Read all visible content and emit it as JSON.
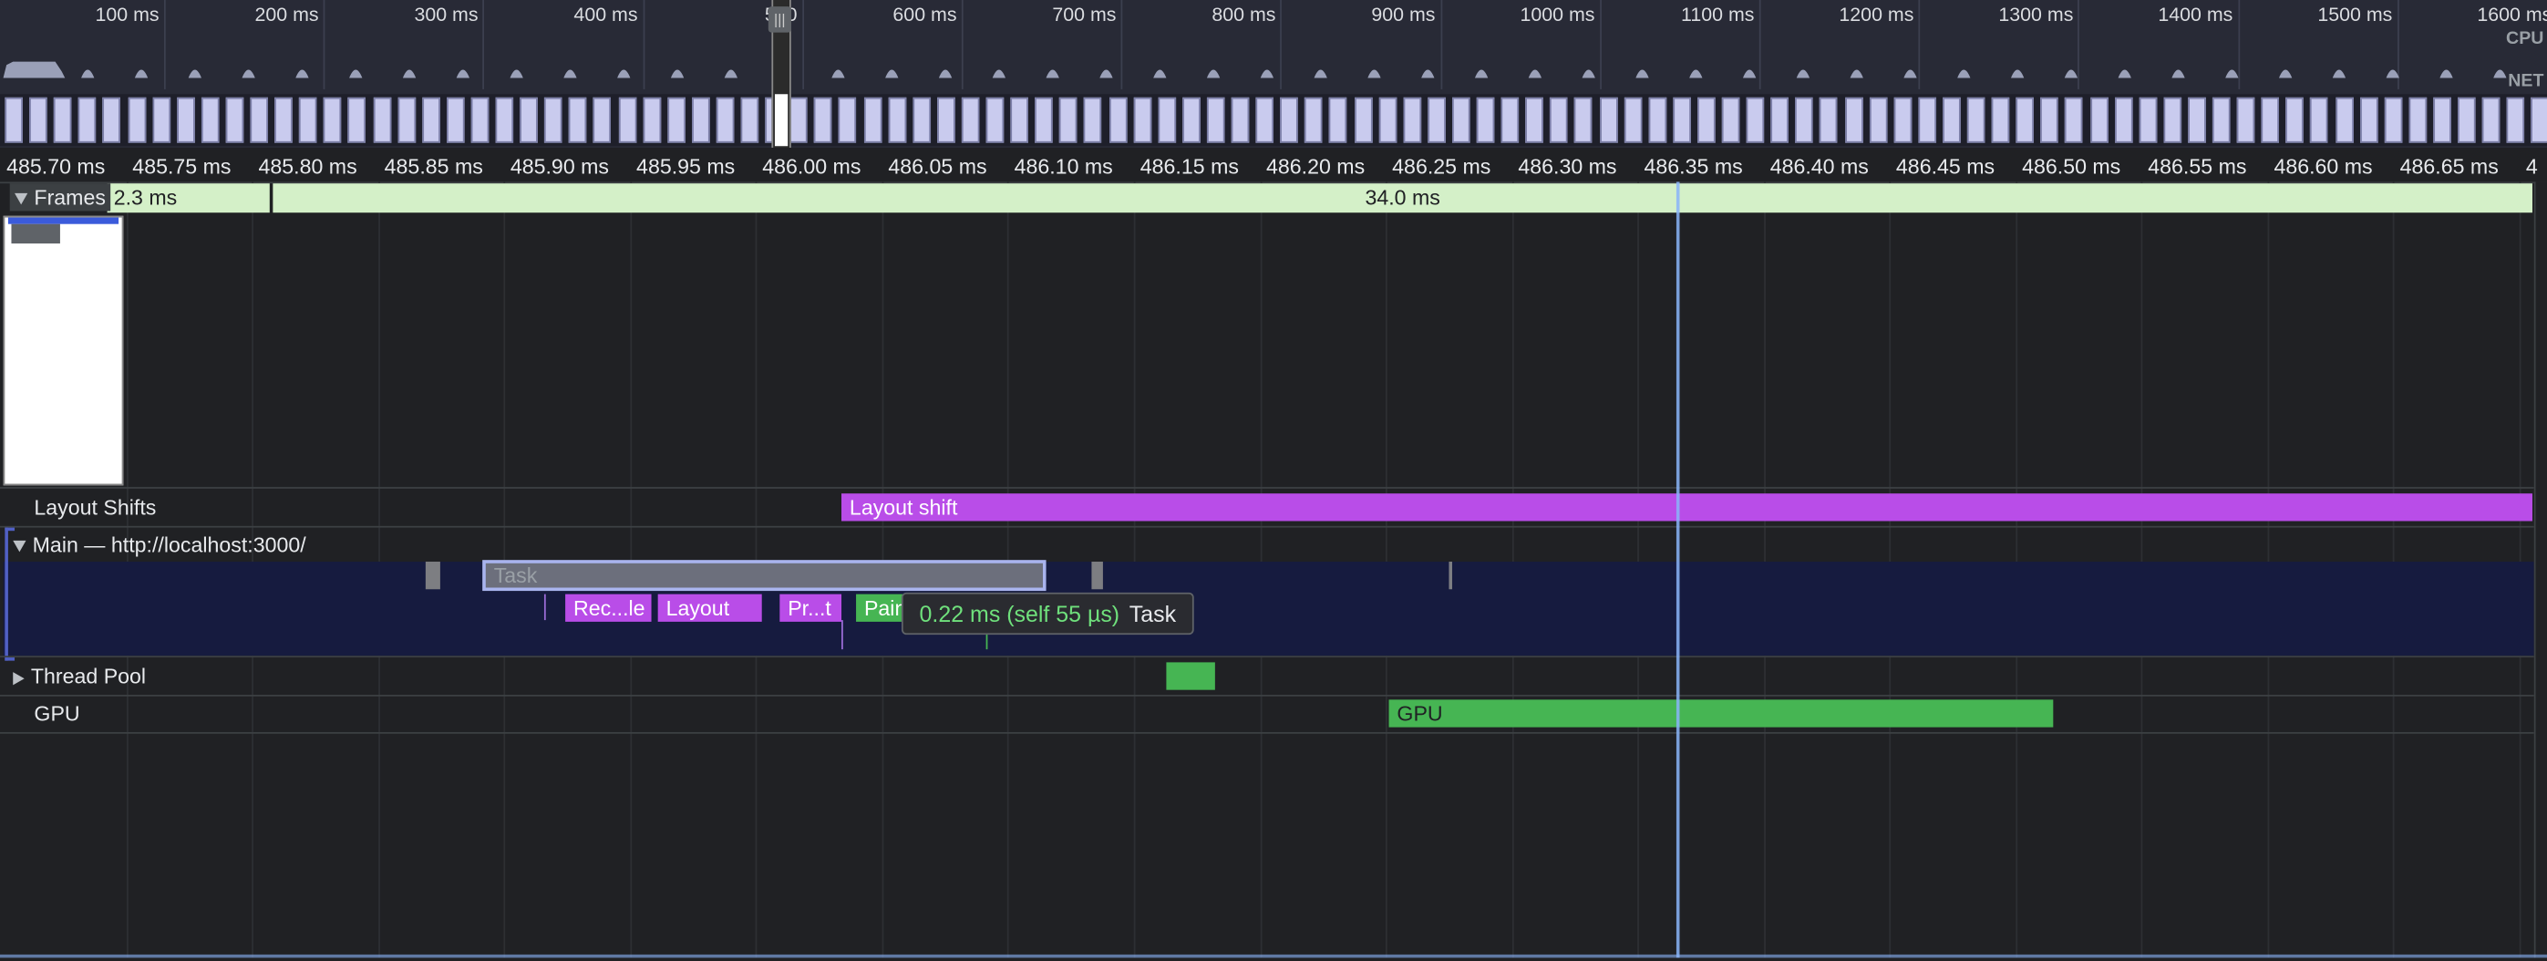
{
  "overview": {
    "tick_labels": [
      "100 ms",
      "200 ms",
      "300 ms",
      "400 ms",
      "500",
      "600 ms",
      "700 ms",
      "800 ms",
      "900 ms",
      "1000 ms",
      "1100 ms",
      "1200 ms",
      "1300 ms",
      "1400 ms",
      "1500 ms",
      "1600 ms"
    ],
    "cpu_label": "CPU",
    "net_label": "NET"
  },
  "ruler": {
    "labels": [
      "485.70 ms",
      "485.75 ms",
      "485.80 ms",
      "485.85 ms",
      "485.90 ms",
      "485.95 ms",
      "486.00 ms",
      "486.05 ms",
      "486.10 ms",
      "486.15 ms",
      "486.20 ms",
      "486.25 ms",
      "486.30 ms",
      "486.35 ms",
      "486.40 ms",
      "486.45 ms",
      "486.50 ms",
      "486.55 ms",
      "486.60 ms",
      "486.65 ms",
      "4"
    ]
  },
  "tracks": {
    "frames": {
      "title": "Frames",
      "frame1": "2.3 ms",
      "frame2": "34.0 ms"
    },
    "layout_shifts": {
      "title": "Layout Shifts",
      "event": "Layout shift"
    },
    "main": {
      "title": "Main — http://localhost:3000/"
    },
    "thread_pool": {
      "title": "Thread Pool"
    },
    "gpu": {
      "title": "GPU",
      "event": "GPU"
    }
  },
  "events": {
    "task": "Task",
    "recalc": "Rec...le",
    "layout": "Layout",
    "prepaint": "Pr...t",
    "paint": "Pain"
  },
  "tooltip": {
    "time": "0.22 ms (self 55 µs)",
    "name": "Task"
  },
  "colors": {
    "purple": "#b94de8",
    "green": "#46b553",
    "frame": "#d4f0c8",
    "selection": "#a9b4ee"
  }
}
